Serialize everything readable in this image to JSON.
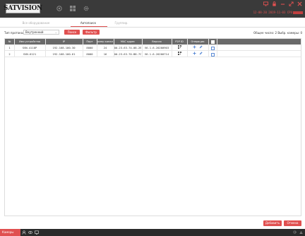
{
  "header": {
    "logo_text": "SATVISION",
    "clock": "12-08-20 2019-11-03 CPU"
  },
  "tabs": [
    {
      "label": "Все оборудование"
    },
    {
      "label": "Автопоиск"
    },
    {
      "label": "Группир."
    }
  ],
  "toolbar": {
    "protocol_label": "Тип протокола:",
    "protocol_value": "Внутренний",
    "search_button": "Поиск",
    "filter_button": "Фильтр",
    "stats": "Общее число: 2   Выбр. камеры: 0"
  },
  "table": {
    "columns": [
      "№",
      "Имя устройства",
      "IP",
      "Порт",
      "омер канал",
      "MAC адрес",
      "Версия",
      "P2P ID",
      "Операции",
      ""
    ],
    "rows": [
      {
        "num": "1",
        "name": "SVN-4118P",
        "ip": "192.168.100.30",
        "port": "8000",
        "channels": "24",
        "mac": "00-23-63-74-08-2E",
        "version": "V6.1.6-20200903"
      },
      {
        "num": "2",
        "name": "SVN-6121",
        "ip": "192.168.100.61",
        "port": "8000",
        "channels": "16",
        "mac": "00-23-63-70-B8-7C",
        "version": "V6.1.6-20200714"
      }
    ]
  },
  "actions": {
    "add_button": "Добавить",
    "cancel_button": "Отмена"
  },
  "taskbar": {
    "start_label": "Камеры"
  },
  "colors": {
    "accent": "#e05050",
    "header_bg": "#3a3a3a",
    "table_header_bg": "#6a6a6a"
  }
}
